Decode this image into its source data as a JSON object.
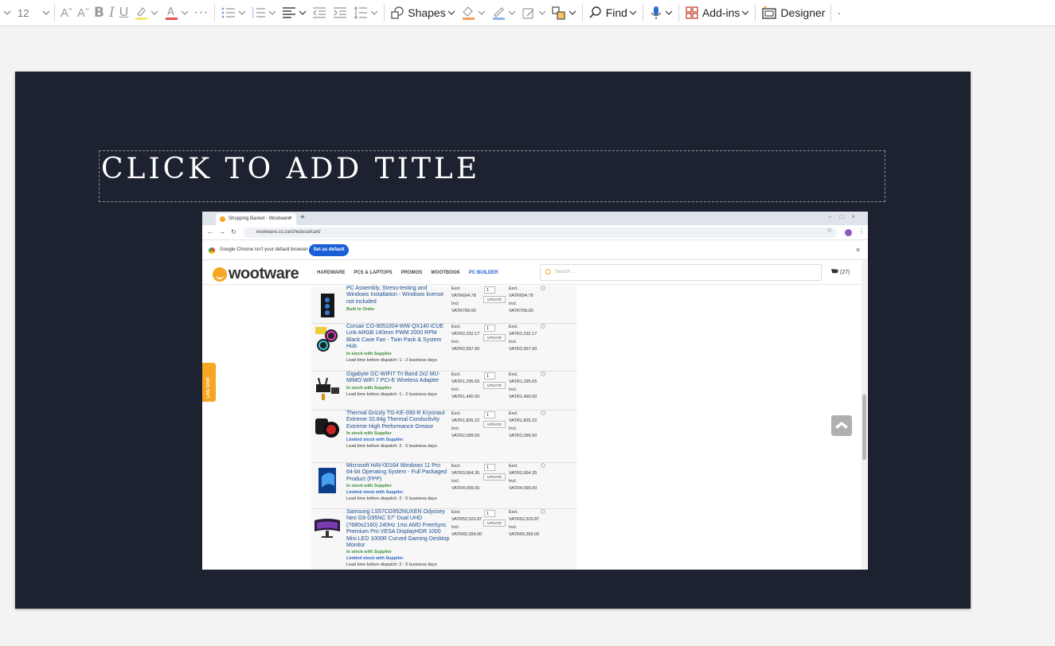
{
  "ribbon": {
    "font_size": "12",
    "shapes_label": "Shapes",
    "find_label": "Find",
    "addins_label": "Add-ins",
    "designer_label": "Designer",
    "colors": {
      "highlight": "#f5e56b",
      "font_color": "#e8534f",
      "shape_fill": "#f39c5b",
      "shape_outline": "#8fb0e6"
    }
  },
  "slide": {
    "title_placeholder": "CLICK TO ADD TITLE",
    "background": "#1d2230"
  },
  "screenshot": {
    "tab_title": "Shopping Basket - Wootware",
    "url": "wootware.co.za/checkout/cart/",
    "notice_text": "Google Chrome isn't your default browser",
    "notice_button": "Set as default",
    "brand": "wootware",
    "nav": [
      "HARDWARE",
      "PCS & LAPTOPS",
      "PROMOS",
      "WOOTBOOK",
      "PC BUILDER"
    ],
    "search_placeholder": "Search ...",
    "cart_count": "(27)",
    "live_chat": "LIVE CHAT",
    "items": [
      {
        "name": "PC Assembly, Stress-testing and Windows Installation - Windows license not included",
        "status": [
          "Built to Order"
        ],
        "lead": "",
        "qty": "",
        "excl": "VATR694.78",
        "incl": "VATR799.00"
      },
      {
        "name": "Corsair CO-9051004-WW QX140 iCUE Link ARGB 140mm PWM 2000 RPM Black Case Fan - Twin Pack & System Hub",
        "status": [
          "In stock with Supplier"
        ],
        "lead": "Lead time before dispatch: 1 - 2 business days",
        "qty": "1",
        "excl": "VATR2,232.17",
        "incl": "VATR2,567.00"
      },
      {
        "name": "Gigabyte GC-WIFI7 Tri Band 2x2 MU-MIMO WiFi 7 PCI-E Wireless Adapter",
        "status": [
          "In stock with Supplier"
        ],
        "lead": "Lead time before dispatch: 1 - 2 business days",
        "qty": "1",
        "excl": "VATR1,295.65",
        "incl": "VATR1,490.00"
      },
      {
        "name": "Thermal Grizzly TG-KE-090-R Kryonaut Extreme 33.84g Thermal Conductivity Extreme High Performance Grease",
        "status": [
          "In stock with Supplier",
          "Limited stock with Supplier"
        ],
        "lead": "Lead time before dispatch: 2 - 5 business days",
        "qty": "1",
        "excl": "VATR1,825.22",
        "incl": "VATR2,099.00"
      },
      {
        "name": "Microsoft HAV-00164 Windows 11 Pro 64-bit Operating System - Full Packaged Product (FPP)",
        "status": [
          "In stock with Supplier",
          "Limited stock with Supplier"
        ],
        "lead": "Lead time before dispatch: 2 - 5 business days",
        "qty": "1",
        "excl": "VATR3,564.35",
        "incl": "VATR4,099.00"
      },
      {
        "name": "Samsung LS57CG952NUXEN Odyssey Neo G9 G95NC 57\" Dual UHD (7680x2160) 240Hz 1ms AMD FreeSync Premium Pro VESA DisplayHDR 1000 Mini LED 1000R Curved Gaming Desktop Monitor",
        "status": [
          "In stock with Supplier",
          "Limited stock with Supplier"
        ],
        "lead": "Lead time before dispatch: 2 - 5 business days",
        "qty": "1",
        "excl": "VATR52,520.87",
        "incl": "VATR60,399.00"
      }
    ],
    "price_excl_label": "Excl.",
    "price_incl_label": "Incl.",
    "update_label": "UPDATE"
  }
}
